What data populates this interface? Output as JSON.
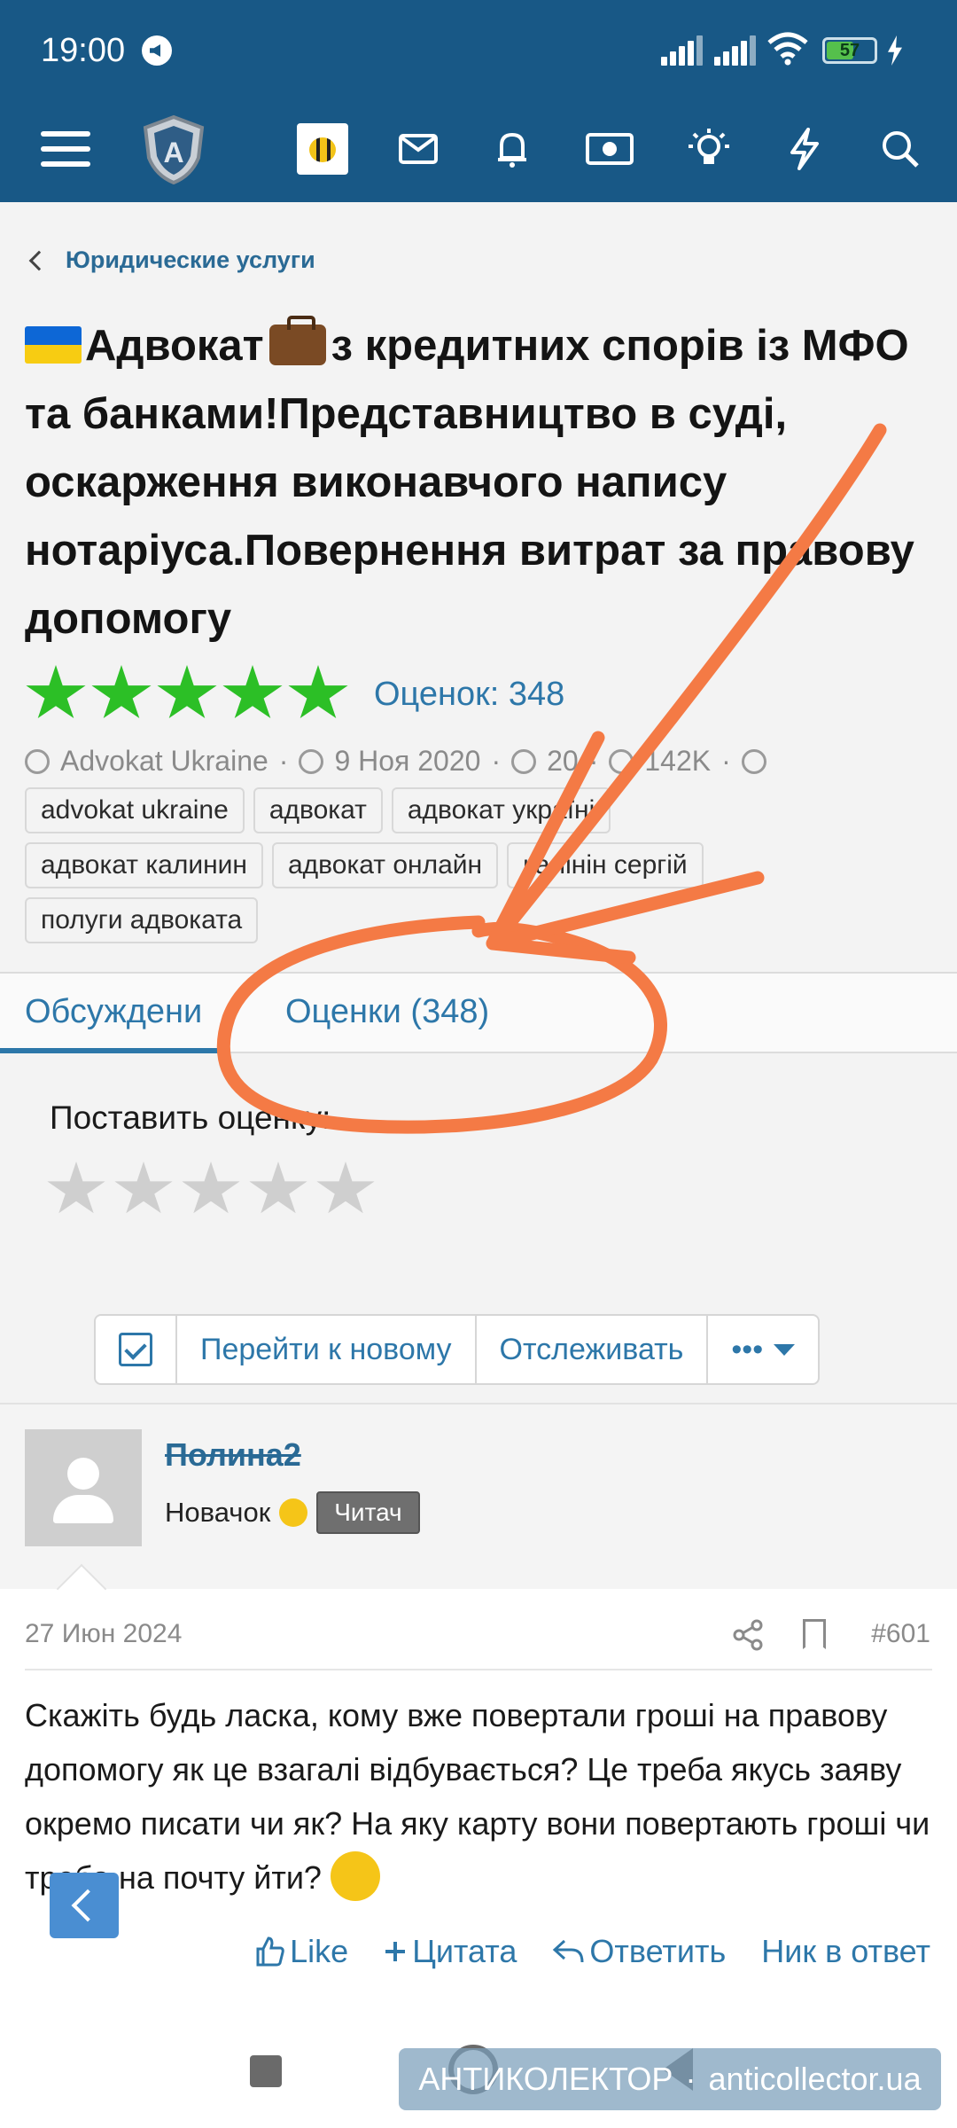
{
  "status": {
    "time": "19:00",
    "battery": "57",
    "battery_level": 0.57
  },
  "header": {
    "icons": [
      "menu-icon",
      "shield-logo",
      "bee-avatar",
      "mail-icon",
      "bell-icon",
      "money-icon",
      "lightbulb-icon",
      "lightning-icon",
      "search-icon"
    ],
    "logo_letter": "A"
  },
  "breadcrumb": {
    "label": "Юридические услуги"
  },
  "thread": {
    "title_part1": "Адвокат",
    "title_part2": "з кредитних спорів із МФО та банками!Представництво в суді, оскарження виконавчого напису нотаріуса.Повернення витрат за правову допомогу",
    "rating_stars": 5,
    "rating_label": "Оценок: 348",
    "author": "Advokat Ukraine",
    "date": "9 Ноя 2020",
    "replies": "20",
    "views": "142K",
    "tags_row1": [
      "advokat ukraine",
      "адвокат",
      "адвокат україні"
    ],
    "tags_row2": [
      "адвокат калинин",
      "адвокат онлайн",
      "калінін сергій"
    ],
    "tags_row3": [
      "полуги адвоката"
    ]
  },
  "tabs": {
    "discussion": "Обсуждени",
    "ratings": "Оценки (348)"
  },
  "rate": {
    "prompt": "Поставить оценку:"
  },
  "toolbar": {
    "goto_new": "Перейти к новому",
    "watch": "Отслеживать",
    "more": "•••"
  },
  "post": {
    "username": "Полина2",
    "rank": "Новачок",
    "badge": "Читач",
    "date": "27 Июн 2024",
    "number": "#601",
    "text": "Скажіть будь ласка, кому вже повертали гроші на правову допомогу як це взагалі відбувається? Це треба якусь заяву окремо писати чи як? На яку карту вони повертають гроші чи треба на почту йти?",
    "actions": {
      "like": "Like",
      "quote": "Цитата",
      "reply": "Ответить",
      "nick": "Ник в ответ"
    }
  },
  "watermark": {
    "left": "АНТИКОЛЕКТОР",
    "sep": "·",
    "right": "anticollector.ua"
  },
  "colors": {
    "header": "#185886",
    "link": "#2d77a9",
    "star_green": "#2cbf26",
    "annotation": "#f47a45"
  }
}
